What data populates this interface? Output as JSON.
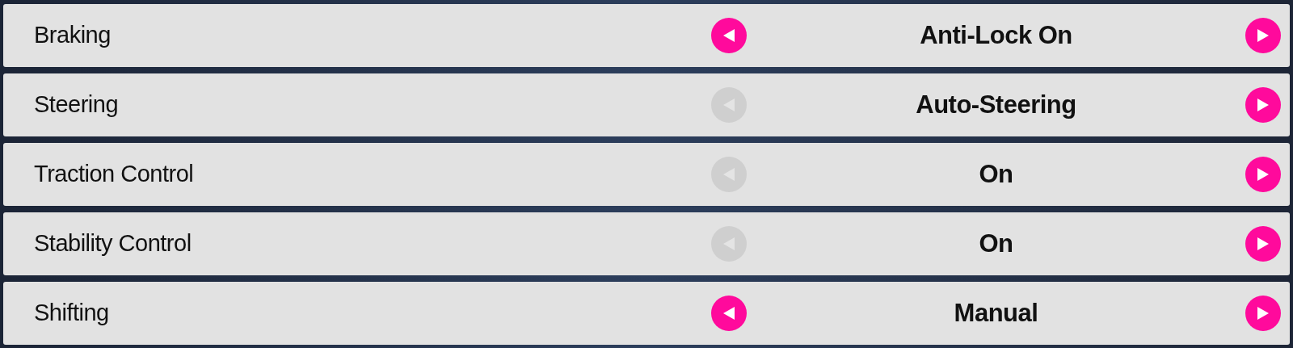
{
  "settings": [
    {
      "label": "Braking",
      "value": "Anti-Lock On",
      "left_enabled": true
    },
    {
      "label": "Steering",
      "value": "Auto-Steering",
      "left_enabled": false
    },
    {
      "label": "Traction Control",
      "value": "On",
      "left_enabled": false
    },
    {
      "label": "Stability Control",
      "value": "On",
      "left_enabled": false
    },
    {
      "label": "Shifting",
      "value": "Manual",
      "left_enabled": true
    }
  ]
}
